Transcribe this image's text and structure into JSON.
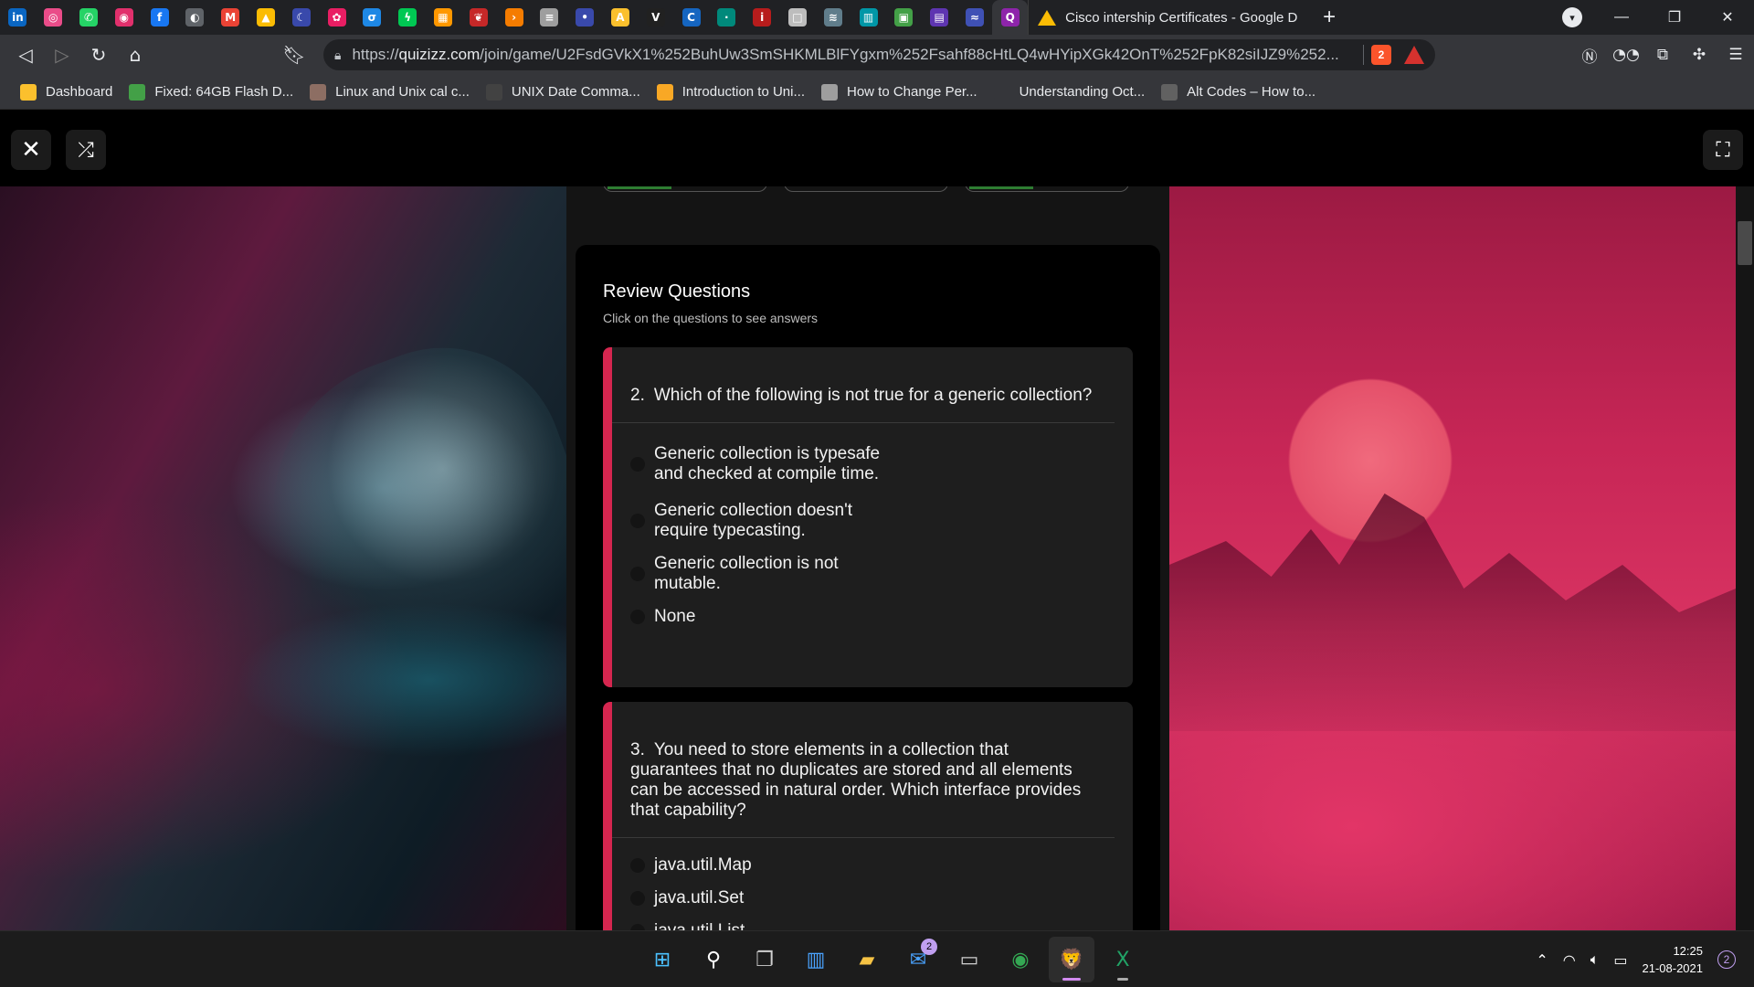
{
  "browser": {
    "pinned_tabs": [
      {
        "icon": "linkedin-icon",
        "glyph": "in",
        "color": "#0a66c2"
      },
      {
        "icon": "dribbble-icon",
        "glyph": "◎",
        "color": "#ea4c89"
      },
      {
        "icon": "whatsapp-icon",
        "glyph": "✆",
        "color": "#25d366"
      },
      {
        "icon": "instagram-icon",
        "glyph": "◉",
        "color": "#e1306c"
      },
      {
        "icon": "facebook-icon",
        "glyph": "f",
        "color": "#1877f2"
      },
      {
        "icon": "globe-icon",
        "glyph": "◐",
        "color": "#5f6368"
      },
      {
        "icon": "gmail-icon",
        "glyph": "M",
        "color": "#ea4335"
      },
      {
        "icon": "drive-icon",
        "glyph": "▲",
        "color": "#fbbc04"
      },
      {
        "icon": "moon-icon",
        "glyph": "☾",
        "color": "#3949ab"
      },
      {
        "icon": "pinwheel-icon",
        "glyph": "✿",
        "color": "#e91e63"
      },
      {
        "icon": "shield-icon",
        "glyph": "σ",
        "color": "#1e88e5"
      },
      {
        "icon": "bolt-icon",
        "glyph": "ϟ",
        "color": "#00c853"
      },
      {
        "icon": "grid-color-icon",
        "glyph": "▦",
        "color": "#ff9800"
      },
      {
        "icon": "red-leaf-icon",
        "glyph": "❦",
        "color": "#c62828"
      },
      {
        "icon": "chevron-right-icon",
        "glyph": "›",
        "color": "#f57c00"
      },
      {
        "icon": "document-icon",
        "glyph": "≡",
        "color": "#9e9e9e"
      },
      {
        "icon": "bullet-icon",
        "glyph": "•",
        "color": "#3949ab"
      },
      {
        "icon": "ai-icon",
        "glyph": "A",
        "color": "#fbc02d"
      },
      {
        "icon": "v-icon",
        "glyph": "V",
        "color": "#212121"
      },
      {
        "icon": "c-icon",
        "glyph": "C",
        "color": "#1565c0"
      },
      {
        "icon": "dot-icon",
        "glyph": "·",
        "color": "#00897b"
      },
      {
        "icon": "ios-icon",
        "glyph": "i",
        "color": "#b71c1c"
      },
      {
        "icon": "paper-icon",
        "glyph": "□",
        "color": "#bdbdbd"
      },
      {
        "icon": "stripes-icon",
        "glyph": "≋",
        "color": "#607d8b"
      },
      {
        "icon": "cisco-icon",
        "glyph": "▥",
        "color": "#0097a7"
      },
      {
        "icon": "squares-icon",
        "glyph": "▣",
        "color": "#43a047"
      },
      {
        "icon": "calendar-icon",
        "glyph": "▤",
        "color": "#5e35b1"
      },
      {
        "icon": "layers-icon",
        "glyph": "≈",
        "color": "#3f51b5"
      },
      {
        "icon": "quizizz-icon",
        "glyph": "Q",
        "color": "#8e24aa",
        "active": true
      }
    ],
    "active_tab_title": "Cisco intership Certificates - Google D",
    "new_tab_label": "+",
    "url_prefix": "https://",
    "url_domain": "quizizz.com",
    "url_path": "/join/game/U2FsdGVkX1%252BuhUw3SmSHKMLBlFYgxm%252Fsahf88cHtLQ4wHYipXGk42OnT%252FpK82siIJZ9%252...",
    "shield_count": "2",
    "bookmarks": [
      {
        "label": "Dashboard",
        "icon": "pencil-icon",
        "color": "#fbc02d"
      },
      {
        "label": "Fixed: 64GB Flash D...",
        "icon": "disk-icon",
        "color": "#43a047"
      },
      {
        "label": "Linux and Unix cal c...",
        "icon": "book-icon",
        "color": "#8d6e63"
      },
      {
        "label": "UNIX Date Comma...",
        "icon": "shell-icon",
        "color": "#424242"
      },
      {
        "label": "Introduction to Uni...",
        "icon": "gfg-icon",
        "color": "#f9a825"
      },
      {
        "label": "How to Change Per...",
        "icon": "globe-icon",
        "color": "#9e9e9e"
      },
      {
        "label": "Understanding Oct...",
        "icon": "blank-icon",
        "color": "#35363a"
      },
      {
        "label": "Alt Codes – How to...",
        "icon": "a-icon",
        "color": "#616161"
      }
    ]
  },
  "quiz": {
    "close_glyph": "✕",
    "shuffle_glyph": "⤮",
    "fullscreen_glyph": "⛶",
    "review_title": "Review Questions",
    "review_subtitle": "Click on the questions to see answers",
    "questions": [
      {
        "number": "2.",
        "text": "Which of the following is not true for a generic collection?",
        "options": [
          "Generic collection is typesafe and checked at compile time.",
          "Generic collection doesn't require typecasting.",
          "Generic collection is not mutable.",
          "None"
        ]
      },
      {
        "number": "3.",
        "text": "You need to store elements in a collection that guarantees that no duplicates are stored and all elements can be accessed in natural order. Which interface provides that capability?",
        "options": [
          "java.util.Map",
          "java.util.Set",
          "java.util.List"
        ]
      }
    ],
    "accent_color": "#d5264f"
  },
  "taskbar": {
    "apps": [
      {
        "icon": "windows-start-icon",
        "glyph": "⊞"
      },
      {
        "icon": "search-icon",
        "glyph": "⚲"
      },
      {
        "icon": "task-view-icon",
        "glyph": "❐"
      },
      {
        "icon": "widgets-icon",
        "glyph": "▥"
      },
      {
        "icon": "file-explorer-icon",
        "glyph": "▰"
      },
      {
        "icon": "mail-icon",
        "glyph": "✉",
        "badge": "2"
      },
      {
        "icon": "terminal-icon",
        "glyph": "▭"
      },
      {
        "icon": "chrome-icon",
        "glyph": "◉"
      },
      {
        "icon": "brave-icon",
        "glyph": "🦁",
        "active": true
      },
      {
        "icon": "excel-icon",
        "glyph": "X"
      }
    ],
    "time": "12:25",
    "date": "21-08-2021",
    "notification_count": "2"
  }
}
